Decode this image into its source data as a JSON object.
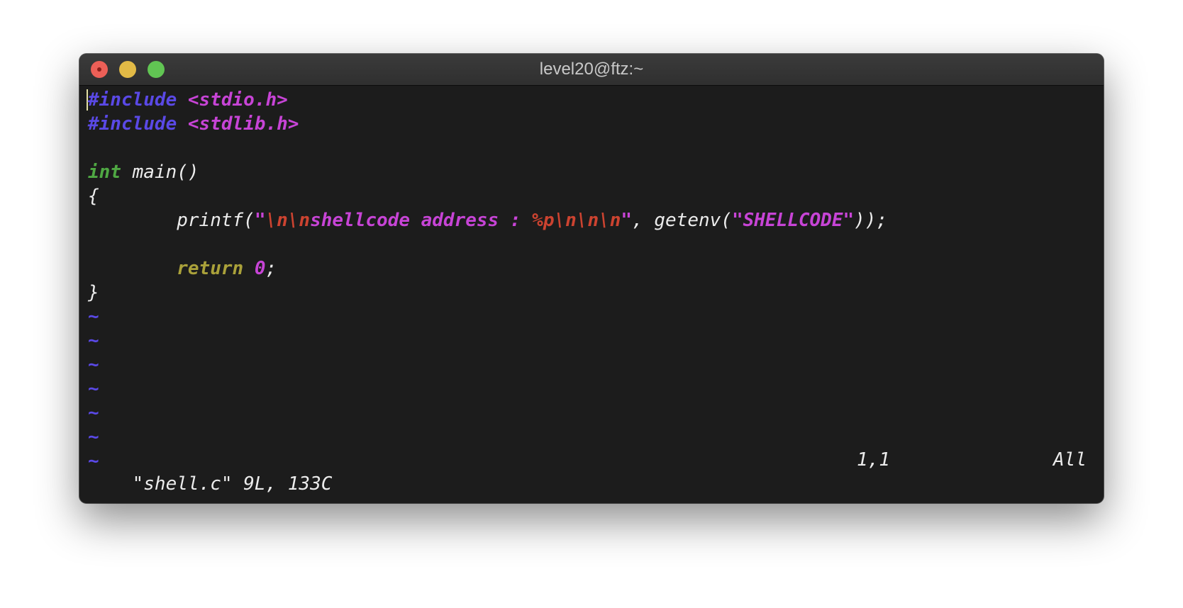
{
  "window": {
    "title": "level20@ftz:~"
  },
  "code": {
    "line1": {
      "directive": "#include",
      "header": "<stdio.h>"
    },
    "line2": {
      "directive": "#include",
      "header": "<stdlib.h>"
    },
    "line4": {
      "type": "int",
      "signature": "main()"
    },
    "line5": {
      "text": "{"
    },
    "line6": {
      "fn": "printf(",
      "str_open": "\"",
      "esc1": "\\n\\n",
      "str_text": "shellcode address : ",
      "esc2": "%p\\n\\n\\n",
      "str_close": "\"",
      "middle": ", getenv(",
      "arg": "\"SHELLCODE\"",
      "end": "));"
    },
    "line8": {
      "keyword": "return",
      "value": "0",
      "end": ";"
    },
    "line9": {
      "text": "}"
    },
    "tilde": "~"
  },
  "status": {
    "file_info": "\"shell.c\" 9L, 133C",
    "position": "1,1",
    "scroll": "All"
  },
  "colors": {
    "background": "#1c1c1c",
    "preproc": "#5a49e6",
    "string": "#c744d6",
    "escape": "#cc4330",
    "type": "#4fa843",
    "keyword": "#aaa13a"
  }
}
